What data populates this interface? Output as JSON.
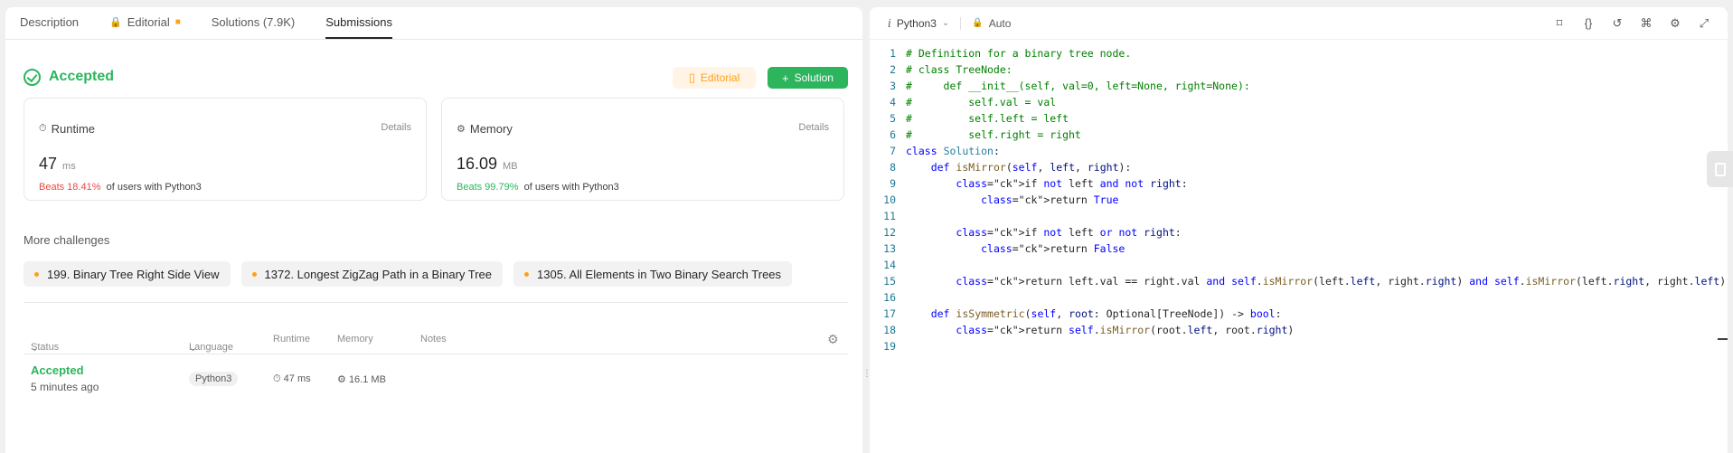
{
  "tabs": [
    {
      "label": "Description"
    },
    {
      "label": "Editorial"
    },
    {
      "label": "Solutions (7.9K)"
    },
    {
      "label": "Submissions"
    }
  ],
  "result": {
    "status": "Accepted",
    "editorial_btn": "Editorial",
    "solution_btn": "Solution"
  },
  "runtime": {
    "label": "Runtime",
    "details": "Details",
    "value": "47",
    "unit": "ms",
    "beats": "Beats 18.41%",
    "beats_suffix": "of users with Python3"
  },
  "memory": {
    "label": "Memory",
    "details": "Details",
    "value": "16.09",
    "unit": "MB",
    "beats": "Beats 99.79%",
    "beats_suffix": "of users with Python3"
  },
  "more": {
    "title": "More challenges",
    "items": [
      "199. Binary Tree Right Side View",
      "1372. Longest ZigZag Path in a Binary Tree",
      "1305. All Elements in Two Binary Search Trees"
    ]
  },
  "submissions": {
    "headers": {
      "status": "Status",
      "language": "Language",
      "runtime": "Runtime",
      "memory": "Memory",
      "notes": "Notes"
    },
    "rows": [
      {
        "status": "Accepted",
        "time": "5 minutes ago",
        "language": "Python3",
        "runtime": "47 ms",
        "memory": "16.1 MB"
      }
    ]
  },
  "editor": {
    "language": "Python3",
    "mode": "Auto",
    "code_lines": [
      {
        "n": "1",
        "text": "# Definition for a binary tree node."
      },
      {
        "n": "2",
        "text": "# class TreeNode:"
      },
      {
        "n": "3",
        "text": "#     def __init__(self, val=0, left=None, right=None):"
      },
      {
        "n": "4",
        "text": "#         self.val = val"
      },
      {
        "n": "5",
        "text": "#         self.left = left"
      },
      {
        "n": "6",
        "text": "#         self.right = right"
      },
      {
        "n": "7",
        "text": "class Solution:"
      },
      {
        "n": "8",
        "text": "    def isMirror(self, left, right):"
      },
      {
        "n": "9",
        "text": "        if not left and not right:"
      },
      {
        "n": "10",
        "text": "            return True"
      },
      {
        "n": "11",
        "text": ""
      },
      {
        "n": "12",
        "text": "        if not left or not right:"
      },
      {
        "n": "13",
        "text": "            return False"
      },
      {
        "n": "14",
        "text": ""
      },
      {
        "n": "15",
        "text": "        return left.val == right.val and self.isMirror(left.left, right.right) and self.isMirror(left.right, right.left)"
      },
      {
        "n": "16",
        "text": ""
      },
      {
        "n": "17",
        "text": "    def isSymmetric(self, root: Optional[TreeNode]) -> bool:"
      },
      {
        "n": "18",
        "text": "        return self.isMirror(root.left, root.right)"
      },
      {
        "n": "19",
        "text": ""
      }
    ]
  },
  "colors": {
    "accepted": "#2db55d",
    "beats_low": "#ef4743",
    "editorial": "#ffa116"
  }
}
